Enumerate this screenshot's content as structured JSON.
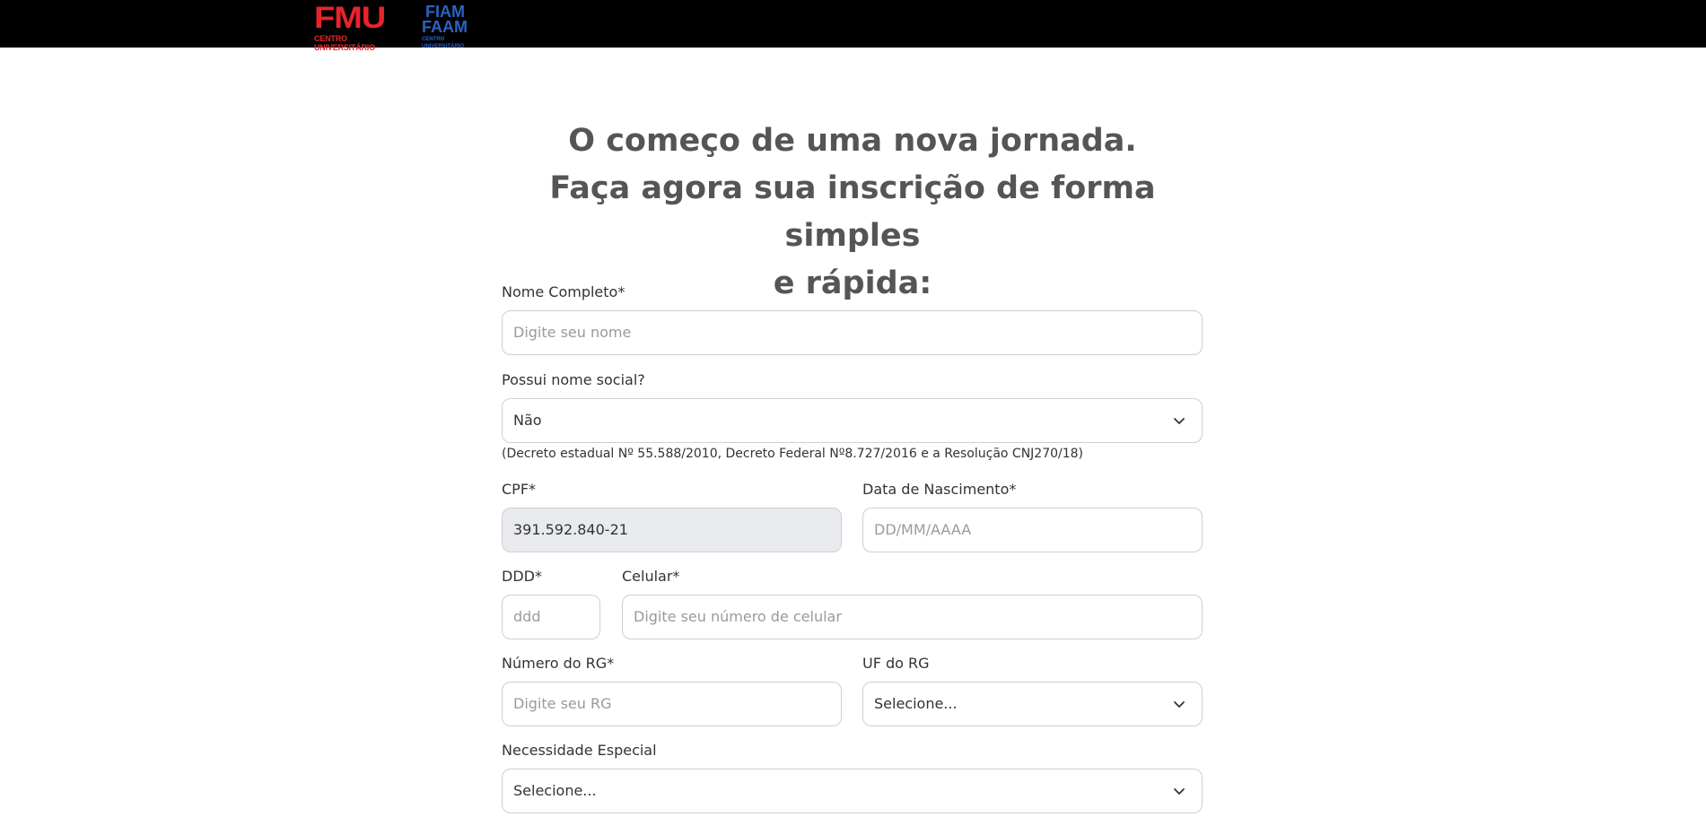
{
  "header": {
    "fmu_logo_text": "FMU",
    "fmu_logo_sub": "CENTRO UNIVERSITÁRIO",
    "fiam_logo_line1": "FIAM",
    "fiam_logo_line2": "FAAM",
    "fiam_logo_sub": "CENTRO UNIVERSITÁRIO"
  },
  "headline": {
    "line1": "O começo de uma nova jornada.",
    "line2": "Faça agora sua inscrição de forma simples",
    "line3": "e rápida:"
  },
  "form": {
    "nome": {
      "label": "Nome Completo*",
      "placeholder": "Digite seu nome"
    },
    "nome_social": {
      "label": "Possui nome social?",
      "value": "Não",
      "note": "(Decreto estadual Nº 55.588/2010, Decreto Federal Nº8.727/2016 e a Resolução CNJ270/18)"
    },
    "cpf": {
      "label": "CPF*",
      "value": "391.592.840-21"
    },
    "nascimento": {
      "label": "Data de Nascimento*",
      "placeholder": "DD/MM/AAAA"
    },
    "ddd": {
      "label": "DDD*",
      "placeholder": "ddd"
    },
    "celular": {
      "label": "Celular*",
      "placeholder": "Digite seu número de celular"
    },
    "rg": {
      "label": "Número do RG*",
      "placeholder": "Digite seu RG"
    },
    "uf_rg": {
      "label": "UF do RG",
      "value": "Selecione..."
    },
    "necessidade": {
      "label": "Necessidade Especial",
      "value": "Selecione..."
    }
  },
  "icons": {
    "select_arrow": "chevron-down-icon"
  },
  "colors": {
    "topbar": "#000000",
    "fmu_red": "#e8242b",
    "fiam_blue": "#2b64c3",
    "headline": "#555555",
    "disabled_bg": "#e8eaed"
  }
}
